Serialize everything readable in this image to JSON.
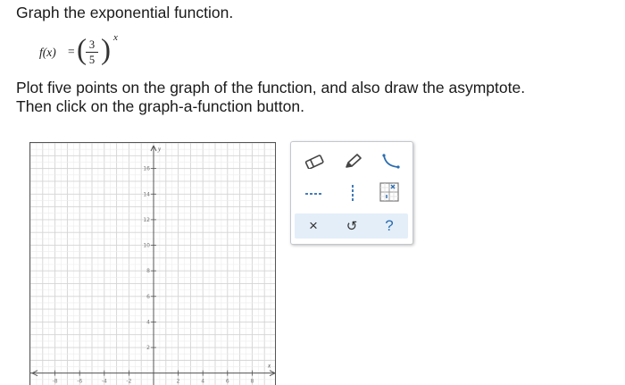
{
  "problem": {
    "prompt": "Graph the exponential function.",
    "formula": {
      "lhs": "f(x)",
      "eq": "=",
      "numerator": "3",
      "denominator": "5",
      "exponent": "x"
    },
    "instruction_line1": "Plot five points on the graph of the function, and also draw the asymptote.",
    "instruction_line2": "Then click on the graph-a-function button."
  },
  "graph": {
    "x_axis_label": "x",
    "y_axis_label": "y",
    "x_range": [
      -10,
      10
    ],
    "y_range": [
      -1,
      18
    ],
    "x_tick_labels": [
      "-8",
      "-6",
      "-4",
      "-2",
      "2",
      "4",
      "6",
      "8"
    ],
    "y_tick_labels": [
      "2",
      "4",
      "6",
      "8",
      "10",
      "12",
      "14",
      "16"
    ],
    "grid": true
  },
  "toolbox": {
    "tools": [
      {
        "name": "eraser-tool",
        "icon": "eraser-icon"
      },
      {
        "name": "pencil-tool",
        "icon": "pencil-icon"
      },
      {
        "name": "curve-tool",
        "icon": "curve-icon"
      },
      {
        "name": "horizontal-asymptote-tool",
        "icon": "horizontal-dashed-line-icon"
      },
      {
        "name": "vertical-asymptote-tool",
        "icon": "vertical-dashed-line-icon"
      },
      {
        "name": "graph-a-function-button",
        "icon": "graph-function-icon"
      }
    ],
    "actions": {
      "clear": "×",
      "undo": "↺",
      "help": "?"
    },
    "colors": {
      "accent": "#2b6cb0",
      "action_bar_bg": "#e3eef8",
      "icon_stroke": "#444444"
    }
  }
}
